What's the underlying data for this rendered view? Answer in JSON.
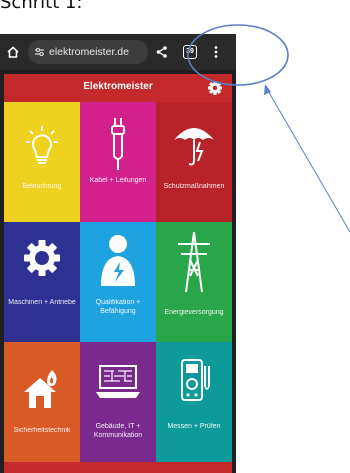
{
  "heading": "Schritt 1:",
  "browser": {
    "url": "elektromeister.de",
    "tab_count": "39"
  },
  "app": {
    "title": "Elektromeister"
  },
  "tiles": [
    {
      "label": "Beleuchtung",
      "color": "#efd21f",
      "icon": "lightbulb-icon"
    },
    {
      "label": "Kabel + Leitungen",
      "color": "#d2218c",
      "icon": "cable-icon"
    },
    {
      "label": "Schutzmaßnahmen",
      "color": "#b8232a",
      "icon": "umbrella-lightning-icon"
    },
    {
      "label": "Maschinen + Antriebe",
      "color": "#2e3192",
      "icon": "gear-icon"
    },
    {
      "label": "Qualifikation + Befähigung",
      "color": "#1ea2e0",
      "icon": "person-bolt-icon"
    },
    {
      "label": "Energieversorgung",
      "color": "#2aa64a",
      "icon": "power-pylon-icon"
    },
    {
      "label": "Sicherheitstechnik",
      "color": "#d85a27",
      "icon": "house-flame-icon"
    },
    {
      "label": "Gebäude, IT + Kommunikation",
      "color": "#7a2a8c",
      "icon": "circuit-board-icon"
    },
    {
      "label": "Messen + Prüfen",
      "color": "#0e9a9a",
      "icon": "multimeter-icon"
    }
  ],
  "colors": {
    "header_red": "#c3292b",
    "annotation_blue": "#5b7fc4"
  }
}
